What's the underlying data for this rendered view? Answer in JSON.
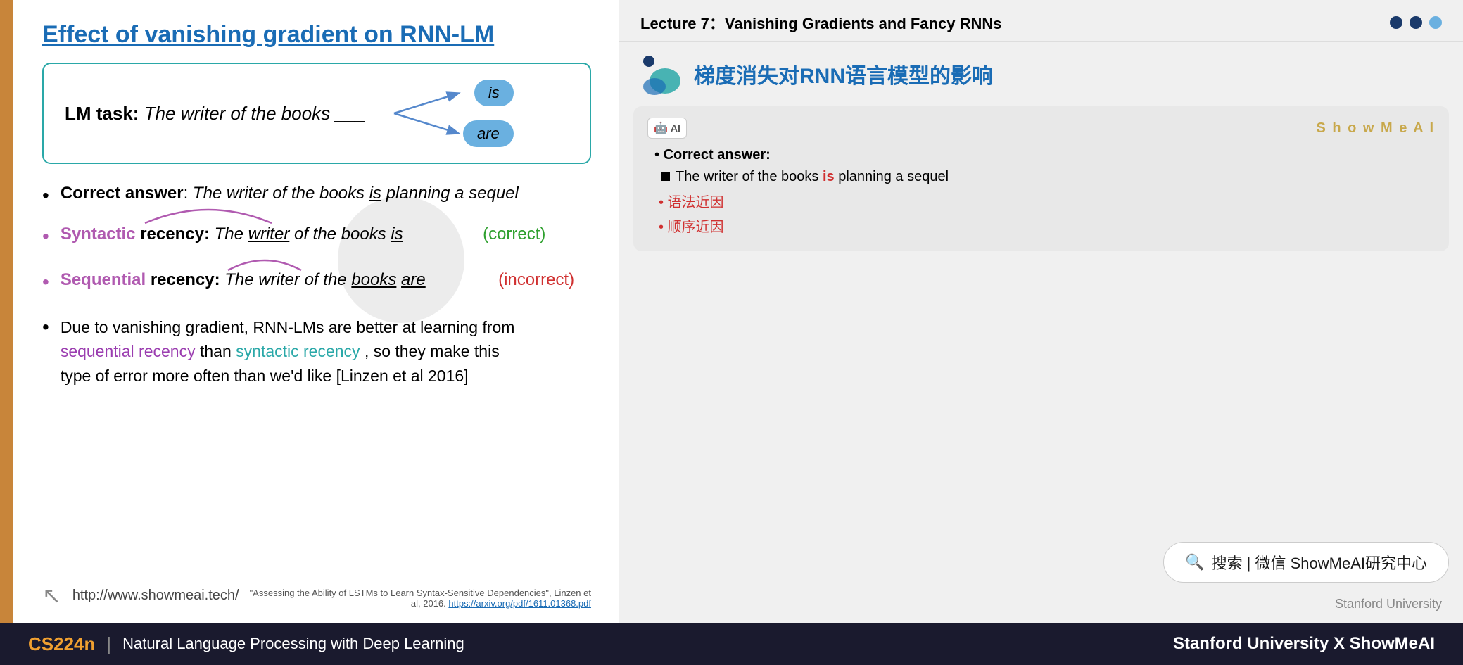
{
  "slide": {
    "title": "Effect of vanishing gradient on RNN-LM",
    "lm_task_label": "LM task:",
    "lm_task_text": " The writer of the books ___",
    "word_is": "is",
    "word_are": "are",
    "bullet1": {
      "label": "Correct answer",
      "colon": ":",
      "text": " The writer of the books ",
      "is_underline": "is",
      "text2": " planning a sequel"
    },
    "bullet2": {
      "label_syntactic": "Syntactic",
      "label_recency": " recency:",
      "text": " The ",
      "writer_underline": "writer",
      "text2": " of the books ",
      "is_underline": "is",
      "spaces": "               ",
      "correct": "(correct)"
    },
    "bullet3": {
      "label_sequential": "Sequential",
      "label_recency": " recency:",
      "text": " The writer of the ",
      "books_underline": "books",
      "space": " ",
      "are_underline": "are",
      "spaces": "              ",
      "incorrect": "(incorrect)"
    },
    "bullet4_line1": "Due to vanishing gradient, RNN-LMs are better at learning from",
    "bullet4_line2_pre": "sequential recency",
    "bullet4_line2_mid": " than ",
    "bullet4_line2_post": "syntactic recency",
    "bullet4_line2_end": ", so they make this",
    "bullet4_line3": "type of error more often than we'd like [Linzen et al 2016]",
    "citation": "\"Assessing the Ability of LSTMs to Learn Syntax-Sensitive Dependencies\", Linzen et al, 2016. ",
    "citation_link": "https://arxiv.org/pdf/1611.01368.pdf",
    "url": "http://www.showmeai.tech/"
  },
  "right_panel": {
    "lecture_title": "Lecture 7：Vanishing Gradients and Fancy RNNs",
    "chinese_title": "梯度消失对RNN语言模型的影响",
    "showmeai_label": "S h o w M e A I",
    "card": {
      "correct_answer_label": "Correct answer:",
      "sub_bullet": "The writer of the books ",
      "sub_is": "is",
      "sub_rest": " planning a sequel",
      "red1": "语法近因",
      "red2": "顺序近因"
    },
    "search_text": "搜索 | 微信 ShowMeAI研究中心"
  },
  "footer": {
    "course": "CS224n",
    "separator": "|",
    "subtitle": "Natural Language Processing with Deep Learning",
    "right": "Stanford University  X  ShowMeAI"
  }
}
